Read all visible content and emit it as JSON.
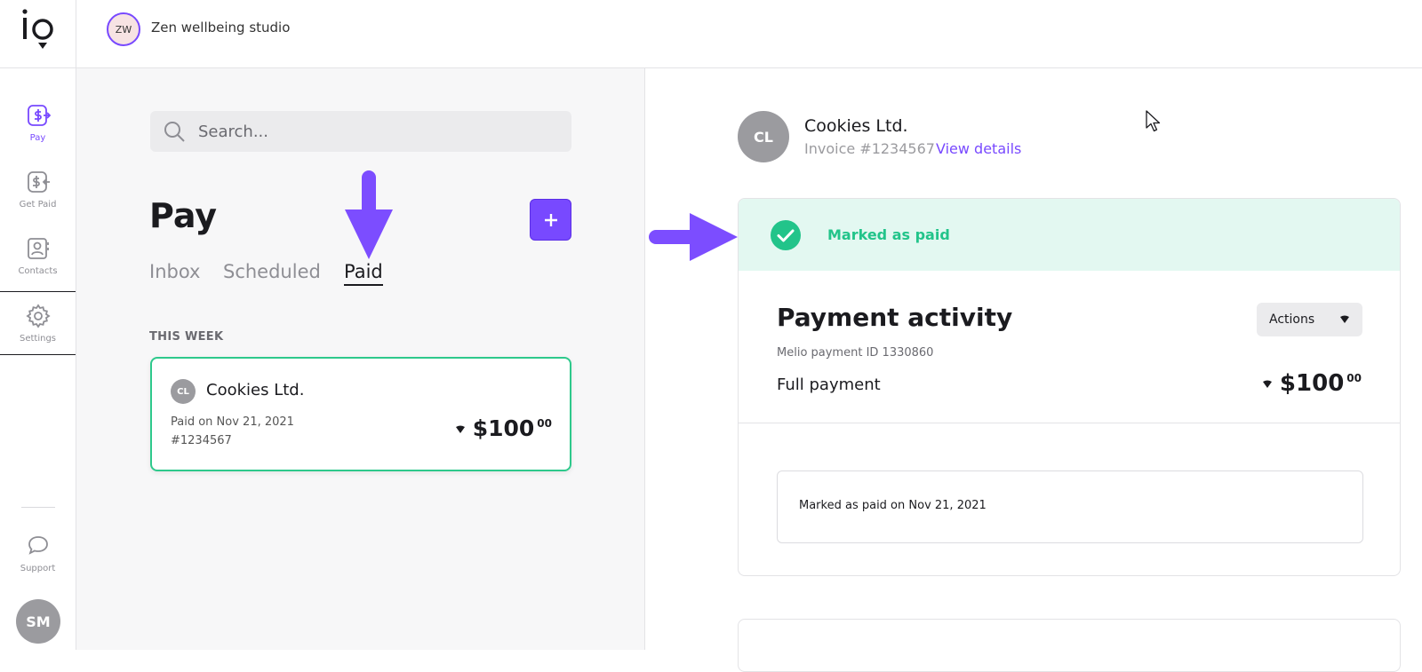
{
  "sidebar": {
    "items": [
      {
        "label": "Pay",
        "icon": "pay-icon"
      },
      {
        "label": "Get Paid",
        "icon": "get-paid-icon"
      },
      {
        "label": "Contacts",
        "icon": "contacts-icon"
      },
      {
        "label": "Settings",
        "icon": "settings-icon"
      }
    ],
    "support_label": "Support",
    "user_initials": "SM"
  },
  "topbar": {
    "org_initials": "ZW",
    "org_name": "Zen wellbeing studio"
  },
  "list": {
    "search_placeholder": "Search...",
    "title": "Pay",
    "tabs": [
      {
        "label": "Inbox",
        "active": false
      },
      {
        "label": "Scheduled",
        "active": false
      },
      {
        "label": "Paid",
        "active": true
      }
    ],
    "section_label": "THIS WEEK",
    "card": {
      "initials": "CL",
      "vendor": "Cookies Ltd.",
      "paid_on": "Paid on Nov 21, 2021",
      "invoice": "#1234567",
      "amount_dollars": "$100",
      "amount_cents": "00"
    }
  },
  "detail": {
    "initials": "CL",
    "vendor": "Cookies Ltd.",
    "invoice": "Invoice #1234567",
    "view_details": "View details",
    "status_text": "Marked as paid",
    "activity_title": "Payment activity",
    "actions_label": "Actions",
    "payment_id": "Melio payment ID 1330860",
    "payment_type": "Full payment",
    "amount_dollars": "$100",
    "amount_cents": "00",
    "timeline_text": "Marked as paid on Nov 21, 2021"
  },
  "colors": {
    "accent": "#7849ff",
    "paid_green": "#22c48a",
    "banner_bg": "#e3f8f1"
  }
}
